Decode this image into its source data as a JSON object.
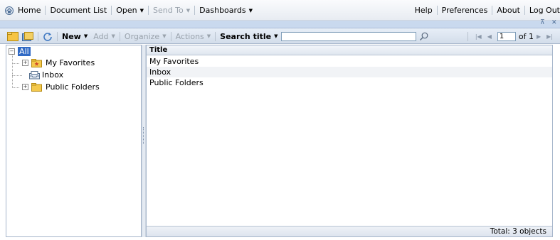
{
  "topbar": {
    "home": "Home",
    "document_list": "Document List",
    "open": "Open",
    "send_to": "Send To",
    "dashboards": "Dashboards",
    "help": "Help",
    "preferences": "Preferences",
    "about": "About",
    "log_out": "Log Out"
  },
  "toolbar": {
    "new": "New",
    "add": "Add",
    "organize": "Organize",
    "actions": "Actions",
    "search_title": "Search title",
    "search_value": "",
    "page_value": "1",
    "page_of": "of 1"
  },
  "tree": {
    "root": "All",
    "items": [
      {
        "label": "My Favorites",
        "icon": "favorites-folder-icon"
      },
      {
        "label": "Inbox",
        "icon": "inbox-icon"
      },
      {
        "label": "Public Folders",
        "icon": "folder-icon"
      }
    ]
  },
  "list": {
    "column_title": "Title",
    "rows": [
      "My Favorites",
      "Inbox",
      "Public Folders"
    ],
    "status": "Total: 3 objects"
  },
  "colors": {
    "accent": "#316ac5",
    "toolbar_bg": "#d3ddea",
    "strip_bg": "#c9d9ee"
  }
}
